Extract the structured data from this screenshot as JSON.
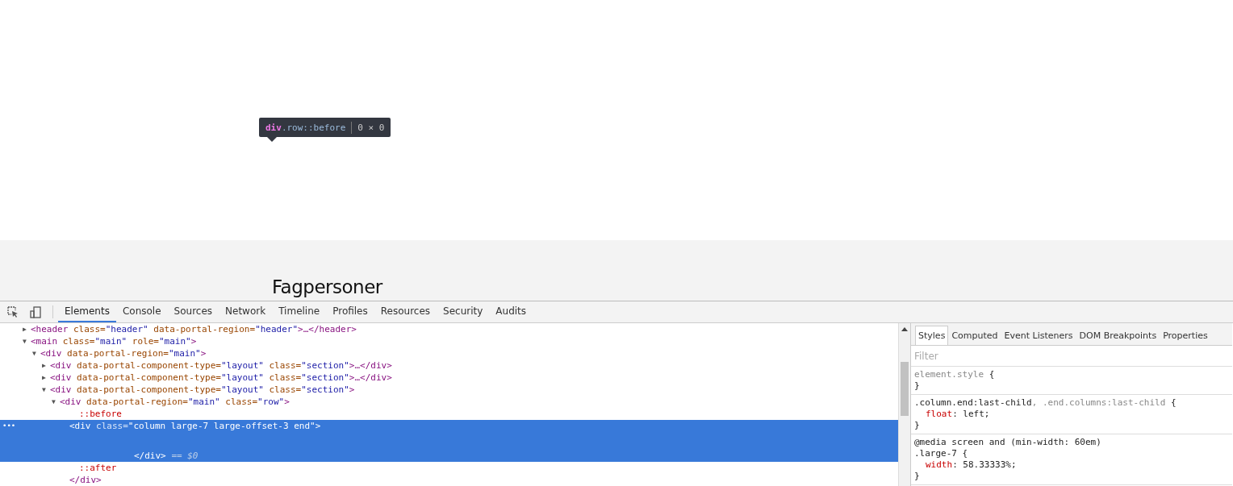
{
  "page": {
    "heading": "Fagpersoner"
  },
  "tooltip": {
    "tag": "div",
    "selector": ".row::before",
    "size": "0 × 0"
  },
  "toolbar": {
    "tabs": [
      {
        "label": "Elements",
        "selected": true
      },
      {
        "label": "Console",
        "selected": false
      },
      {
        "label": "Sources",
        "selected": false
      },
      {
        "label": "Network",
        "selected": false
      },
      {
        "label": "Timeline",
        "selected": false
      },
      {
        "label": "Profiles",
        "selected": false
      },
      {
        "label": "Resources",
        "selected": false
      },
      {
        "label": "Security",
        "selected": false
      },
      {
        "label": "Audits",
        "selected": false
      }
    ]
  },
  "dom_tree": [
    {
      "kind": "element",
      "toggle": "▶",
      "tag": "<header",
      "attrs": [
        {
          "name": "class=",
          "value": "\"header\""
        },
        {
          "name": "data-portal-region=",
          "value": "\"header\""
        }
      ],
      "tag_end": ">…</header>",
      "selected": false
    },
    {
      "kind": "element",
      "toggle": "▼",
      "tag": "<main",
      "attrs": [
        {
          "name": "class=",
          "value": "\"main\""
        },
        {
          "name": "role=",
          "value": "\"main\""
        }
      ],
      "tag_end": ">",
      "selected": false,
      "children": [
        {
          "kind": "element",
          "toggle": "▼",
          "tag": "<div",
          "attrs": [
            {
              "name": "data-portal-region=",
              "value": "\"main\""
            }
          ],
          "tag_end": ">",
          "selected": false,
          "children": [
            {
              "kind": "element",
              "toggle": "▶",
              "tag": "<div",
              "attrs": [
                {
                  "name": "data-portal-component-type=",
                  "value": "\"layout\""
                },
                {
                  "name": "class=",
                  "value": "\"section\""
                }
              ],
              "tag_end": ">…</div>",
              "selected": false
            },
            {
              "kind": "element",
              "toggle": "▶",
              "tag": "<div",
              "attrs": [
                {
                  "name": "data-portal-component-type=",
                  "value": "\"layout\""
                },
                {
                  "name": "class=",
                  "value": "\"section\""
                }
              ],
              "tag_end": ">…</div>",
              "selected": false
            },
            {
              "kind": "element",
              "toggle": "▼",
              "tag": "<div",
              "attrs": [
                {
                  "name": "data-portal-component-type=",
                  "value": "\"layout\""
                },
                {
                  "name": "class=",
                  "value": "\"section\""
                }
              ],
              "tag_end": ">",
              "selected": false,
              "children": [
                {
                  "kind": "element",
                  "toggle": "▼",
                  "tag": "<div",
                  "attrs": [
                    {
                      "name": "data-portal-region=",
                      "value": "\"main\""
                    },
                    {
                      "name": "class=",
                      "value": "\"row\""
                    }
                  ],
                  "tag_end": ">",
                  "selected": false,
                  "close_tag": "</div>",
                  "children": [
                    {
                      "kind": "pseudo",
                      "text": "::before"
                    },
                    {
                      "kind": "element",
                      "tag": "<div",
                      "attrs": [
                        {
                          "name": "class=",
                          "value": "\"column large-7 large-offset-3 end\""
                        }
                      ],
                      "tag_end": ">",
                      "selected": true,
                      "dots": "•••",
                      "close_tag": "</div>",
                      "console_ref": "== $0"
                    },
                    {
                      "kind": "pseudo",
                      "text": "::after"
                    }
                  ]
                }
              ]
            }
          ]
        }
      ]
    }
  ],
  "sidebar": {
    "tabs": [
      {
        "label": "Styles",
        "selected": true
      },
      {
        "label": "Computed",
        "selected": false
      },
      {
        "label": "Event Listeners",
        "selected": false
      },
      {
        "label": "DOM Breakpoints",
        "selected": false
      },
      {
        "label": "Properties",
        "selected": false
      }
    ],
    "filter": {
      "placeholder": "Filter"
    },
    "rules": [
      {
        "selector": "element.style",
        "inline": true,
        "open": " {",
        "close": "}"
      },
      {
        "selector": ".column.end:last-child",
        "selector_inactive": ", .end.columns:last-child",
        "inline": false,
        "open": " {",
        "declarations": [
          {
            "name": "float",
            "value": ": left;"
          }
        ],
        "close": "}"
      },
      {
        "media": "@media screen and (min-width: 60em)",
        "selector": ".large-7",
        "inline": false,
        "open": " {",
        "declarations": [
          {
            "name": "width",
            "value": ": 58.33333%;"
          }
        ],
        "close": "}"
      }
    ]
  }
}
